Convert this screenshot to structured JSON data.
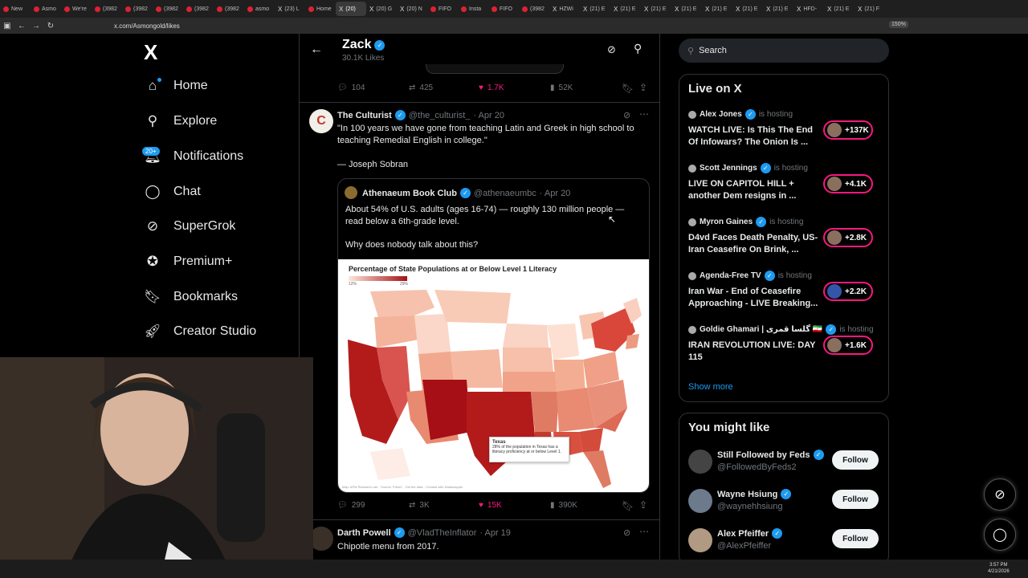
{
  "browser": {
    "tabs": [
      "New",
      "Asmo",
      "We're",
      "(3982",
      "(3982",
      "(3982",
      "(3982",
      "(3982",
      "asmo",
      "(23) L",
      "Home",
      "(20)",
      "(20) G",
      "(20) N",
      "FIFO",
      "Insta",
      "FIFO",
      "(3982",
      "HZWi",
      "(21) E",
      "(21) E",
      "(21) E",
      "(21) E",
      "(21) E",
      "(21) E",
      "(21) E",
      "HFD-",
      "(21) E",
      "(21) F"
    ],
    "active_tab_index": 11,
    "url": "x.com/Asmongold/likes",
    "zoom": "150%"
  },
  "nav": {
    "logo": "X",
    "items": [
      "Home",
      "Explore",
      "Notifications",
      "Chat",
      "SuperGrok",
      "Premium+",
      "Bookmarks",
      "Creator Studio"
    ],
    "notifications_badge": "20+"
  },
  "header": {
    "name": "Zack",
    "sub": "30.1K Likes"
  },
  "prev_tweet": {
    "replies": "104",
    "reposts": "425",
    "likes": "1.7K",
    "views": "52K"
  },
  "tweet": {
    "name": "The Culturist",
    "handle": "@the_culturist_",
    "date": "· Apr 20",
    "text_line1": "\"In 100 years we have gone from teaching Latin and Greek in high school to",
    "text_line2": "teaching Remedial English in college.\"",
    "attribution": "— Joseph Sobran",
    "replies": "299",
    "reposts": "3K",
    "likes": "15K",
    "views": "390K",
    "quote": {
      "name": "Athenaeum Book Club",
      "handle": "@athenaeumbc",
      "date": "· Apr 20",
      "text_line1": "About 54% of U.S. adults (ages 16-74) — roughly 130 million people —",
      "text_line2": "read below a 6th-grade level.",
      "text_line3": "Why does nobody talk about this?",
      "map": {
        "title": "Percentage of State Populations at or Below Level 1 Literacy",
        "legend_min": "12%",
        "legend_max": "29%",
        "tooltip_title": "Texas",
        "tooltip_body": "28% of the population in Texas has a literacy proficiency at or below Level 1.",
        "footer": "Map: APM Research Lab · Source: PIAAC · Get the data · Created with Datawrapper"
      }
    }
  },
  "next_tweet": {
    "name": "Darth Powell",
    "handle": "@VladTheInflator",
    "date": "· Apr 19",
    "text": "Chipotle menu from 2017."
  },
  "search": {
    "placeholder": "Search"
  },
  "live": {
    "title": "Live on X",
    "hosting_label": "is hosting",
    "items": [
      {
        "host": "Alex Jones",
        "title": "WATCH LIVE: Is This The End Of Infowars? The Onion Is ...",
        "count": "+137K"
      },
      {
        "host": "Scott Jennings",
        "title": "LIVE ON CAPITOL HILL + another Dem resigns in ...",
        "count": "+4.1K"
      },
      {
        "host": "Myron Gaines",
        "title": "D4vd Faces Death Penalty, US-Iran Ceasefire On Brink, ...",
        "count": "+2.8K"
      },
      {
        "host": "Agenda-Free TV",
        "title": "Iran War - End of Ceasefire Approaching - LIVE Breaking...",
        "count": "+2.2K"
      },
      {
        "host": "Goldie Ghamari | گلسا قمری 🇮🇷",
        "title": "IRAN REVOLUTION LIVE: DAY 115",
        "count": "+1.6K"
      }
    ],
    "show_more": "Show more"
  },
  "might_like": {
    "title": "You might like",
    "follow_label": "Follow",
    "items": [
      {
        "name": "Still Followed by Feds",
        "handle": "@FollowedByFeds2"
      },
      {
        "name": "Wayne Hsiung",
        "handle": "@waynehhsiung"
      },
      {
        "name": "Alex Pfeiffer",
        "handle": "@AlexPfeiffer"
      }
    ]
  },
  "taskbar": {
    "time": "3:57 PM",
    "date": "4/21/2026"
  }
}
